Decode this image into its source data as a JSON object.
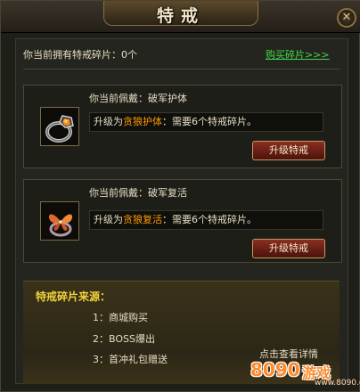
{
  "window": {
    "title": "特戒",
    "close_label": "✕"
  },
  "owned": {
    "text": "你当前拥有特戒碎片：0个",
    "buy_link": "购买碎片>>>"
  },
  "rings": [
    {
      "wearing": "你当前佩戴：破军护体",
      "info_prefix": "升级为",
      "target": "贪狼护体",
      "info_suffix": "：需要6个特戒碎片。",
      "button": "升级特戒",
      "icon": "ring-orange-gem-icon"
    },
    {
      "wearing": "你当前佩戴：破军复活",
      "info_prefix": "升级为",
      "target": "贪狼复活",
      "info_suffix": "：需要6个特戒碎片。",
      "button": "升级特戒",
      "icon": "ring-butterfly-icon"
    }
  ],
  "sources": {
    "title": "特戒碎片来源：",
    "items": [
      "1：商城购买",
      "2：BOSS爆出",
      "3：首冲礼包赠送"
    ],
    "detail_link": "点击查看详情"
  },
  "watermark": {
    "number": "8090",
    "brand": "游戏",
    "url": "www.8090.com"
  },
  "colors": {
    "link": "#3fd84a",
    "highlight": "#ff9a00",
    "source_title": "#f2d23a",
    "button": "#8a2e22"
  }
}
